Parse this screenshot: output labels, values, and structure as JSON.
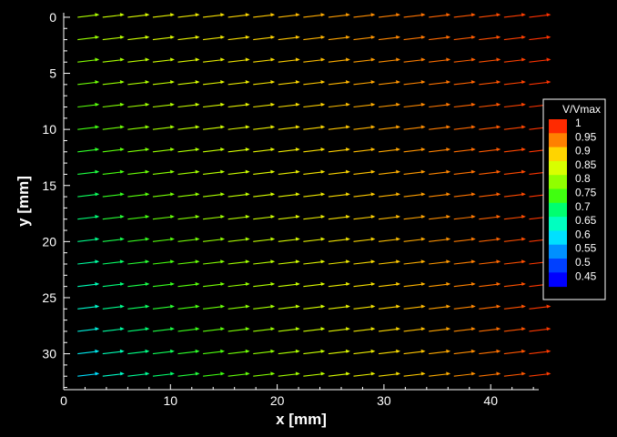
{
  "chart_data": {
    "type": "vector_field",
    "xlabel": "x [mm]",
    "ylabel": "y [mm]",
    "xlim": [
      0,
      44.5
    ],
    "ylim": [
      33.2,
      -0.4
    ],
    "y_axis_direction": "down",
    "xticks": [
      0,
      10,
      20,
      30,
      40
    ],
    "yticks": [
      0,
      5,
      10,
      15,
      20,
      25,
      30
    ],
    "grid": {
      "x": [
        1.3,
        45
      ],
      "y": [
        0,
        32
      ],
      "dx": 2.35,
      "dy": 2
    },
    "vector_direction": "left-to-right, slightly upward",
    "magnitude_range": {
      "left_low_y": 0.6,
      "left_high_y": 0.82,
      "right": 1.0
    },
    "colormap": {
      "title": "V/Vmax",
      "levels": [
        "1",
        "0.95",
        "0.9",
        "0.85",
        "0.8",
        "0.75",
        "0.7",
        "0.65",
        "0.6",
        "0.55",
        "0.5",
        "0.45"
      ],
      "colors": [
        "#ff2a00",
        "#ff8000",
        "#ffd400",
        "#d8ff00",
        "#90ff00",
        "#40ff10",
        "#00ff70",
        "#00ffc0",
        "#00e0ff",
        "#0090ff",
        "#0040ff",
        "#0000ff"
      ],
      "placement": "right"
    }
  }
}
